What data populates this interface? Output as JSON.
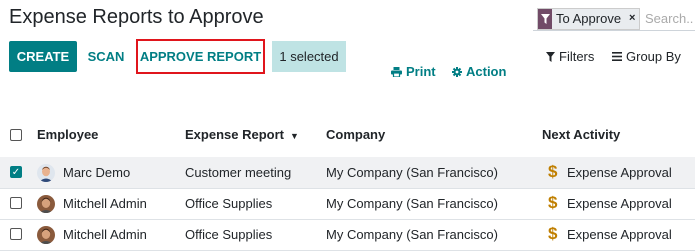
{
  "page": {
    "title": "Expense Reports to Approve"
  },
  "search": {
    "facet_icon": "filter-icon",
    "facet_value": "To Approve",
    "facet_remove": "×",
    "placeholder": "Search..."
  },
  "toolbar": {
    "create": "CREATE",
    "scan": "SCAN",
    "approve_report": "APPROVE REPORT",
    "selected_count": "1 selected",
    "print": "Print",
    "action": "Action",
    "filters": "Filters",
    "group_by": "Group By"
  },
  "table": {
    "headers": {
      "employee": "Employee",
      "expense_report": "Expense Report",
      "company": "Company",
      "next_activity": "Next Activity"
    },
    "rows": [
      {
        "checked": true,
        "avatar": "avatar-marc",
        "employee": "Marc Demo",
        "expense_report": "Customer meeting",
        "company": "My Company (San Francisco)",
        "activity_icon": "dollar-icon",
        "next_activity": "Expense Approval"
      },
      {
        "checked": false,
        "avatar": "avatar-mitchell",
        "employee": "Mitchell Admin",
        "expense_report": "Office Supplies",
        "company": "My Company (San Francisco)",
        "activity_icon": "dollar-icon",
        "next_activity": "Expense Approval"
      },
      {
        "checked": false,
        "avatar": "avatar-mitchell",
        "employee": "Mitchell Admin",
        "expense_report": "Office Supplies",
        "company": "My Company (San Francisco)",
        "activity_icon": "dollar-icon",
        "next_activity": "Expense Approval"
      }
    ]
  },
  "colors": {
    "primary": "#017e84",
    "facet": "#714b67",
    "highlight_border": "#e0151c",
    "selected_badge": "#bfe3e4",
    "activity_icon": "#c07f00"
  }
}
